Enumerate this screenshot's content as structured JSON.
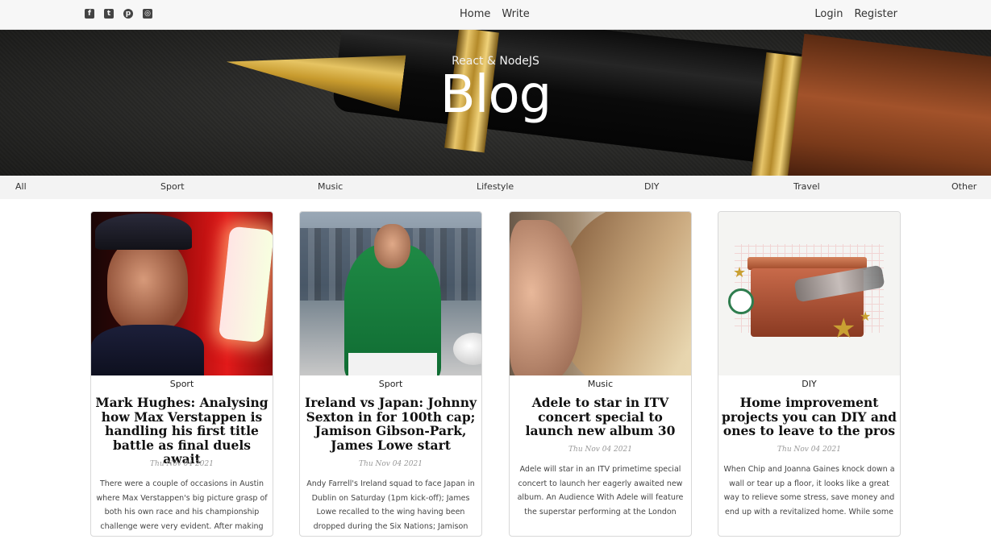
{
  "header": {
    "social": [
      {
        "icon": "facebook-icon",
        "glyph": "f"
      },
      {
        "icon": "twitter-icon",
        "glyph": "t"
      },
      {
        "icon": "pinterest-icon",
        "glyph": "p"
      },
      {
        "icon": "instagram-icon",
        "glyph": "◎"
      }
    ],
    "nav": {
      "home": "Home",
      "write": "Write"
    },
    "auth": {
      "login": "Login",
      "register": "Register"
    }
  },
  "banner": {
    "subtitle": "React & NodeJS",
    "title": "Blog"
  },
  "categories": [
    "All",
    "Sport",
    "Music",
    "Lifestyle",
    "DIY",
    "Travel",
    "Other"
  ],
  "posts": [
    {
      "category": "Sport",
      "title": "Mark Hughes: Analysing how Max Verstappen is handling his first title battle as final duels await",
      "date": "Thu Nov 04 2021",
      "desc": "There were a couple of occasions in Austin where Max Verstappen's big picture grasp of both his own race and his championship challenge were very evident. After making his first stop early in ..."
    },
    {
      "category": "Sport",
      "title": "Ireland vs Japan: Johnny Sexton in for 100th cap; Jamison Gibson-Park, James Lowe start",
      "date": "Thu Nov 04 2021",
      "desc": "Andy Farrell's Ireland squad to face Japan in Dublin on Saturday (1pm kick-off); James Lowe recalled to the wing having been dropped during the Six Nations; Jamison Gibson-Park starts at..."
    },
    {
      "category": "Music",
      "title": "Adele to star in ITV concert special to launch new album 30",
      "date": "Thu Nov 04 2021",
      "desc": "Adele will star in an ITV primetime special concert to launch her eagerly awaited new album. An Audience With Adele will feature the superstar performing at the London Palladium, ITV said. T..."
    },
    {
      "category": "DIY",
      "title": "Home improvement projects you can DIY and ones to leave to the pros",
      "date": "Thu Nov 04 2021",
      "desc": "When Chip and Joanna Gaines knock down a wall or tear up a floor, it looks like a great way to relieve some stress, save money and end up with a revitalized home. While some projects can be ea..."
    }
  ]
}
